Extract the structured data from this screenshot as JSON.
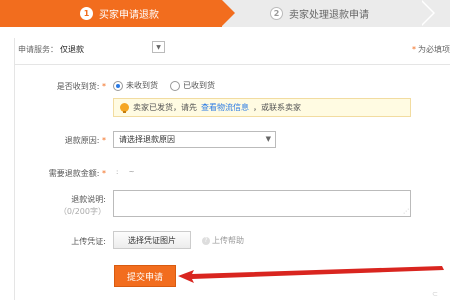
{
  "steps": [
    {
      "num": "1",
      "label": "买家申请退款"
    },
    {
      "num": "2",
      "label": "卖家处理退款申请"
    }
  ],
  "header": {
    "service_label": "申请服务：",
    "service_value": "仅退款",
    "required_note": "为必填项"
  },
  "form": {
    "received_label": "是否收到货:",
    "radio_not_received": "未收到货",
    "radio_received": "已收到货",
    "notice_text_1": "卖家已发货，请先",
    "notice_link": "查看物流信息",
    "notice_text_2": "，或联系卖家",
    "reason_label": "退款原因:",
    "reason_select": "请选择退款原因",
    "amount_label": "需要退款金额:",
    "desc_label": "退款说明:",
    "desc_count": "（0/200字）",
    "upload_label": "上传凭证:",
    "upload_button": "选择凭证图片",
    "upload_help": "上传帮助",
    "submit_button": "提交申请"
  },
  "colors": {
    "accent": "#f26d1e",
    "link": "#2a7ae4",
    "arrow": "#d9251f"
  }
}
